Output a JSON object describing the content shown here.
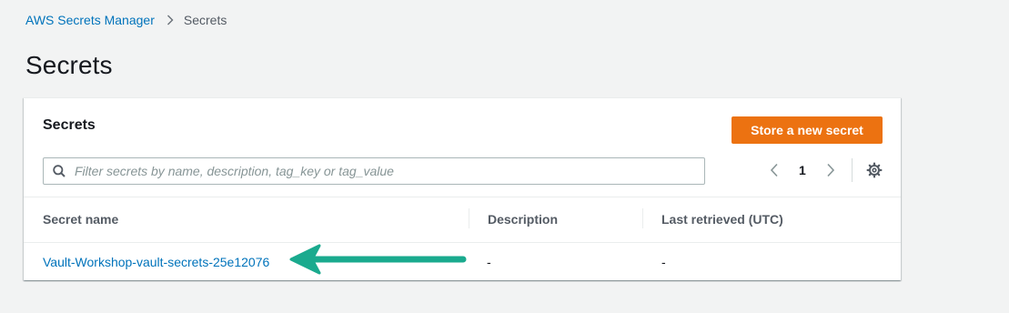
{
  "breadcrumb": {
    "root": "AWS Secrets Manager",
    "current": "Secrets"
  },
  "page": {
    "title": "Secrets"
  },
  "panel": {
    "title": "Secrets",
    "primary_button": "Store a new secret",
    "search_placeholder": "Filter secrets by name, description, tag_key or tag_value",
    "search_value": "",
    "pagination": {
      "current_page": "1"
    }
  },
  "table": {
    "columns": [
      "Secret name",
      "Description",
      "Last retrieved (UTC)"
    ],
    "rows": [
      {
        "name": "Vault-Workshop-vault-secrets-25e12076",
        "description": "-",
        "last_retrieved": "-"
      }
    ]
  },
  "colors": {
    "primary": "#ec7211",
    "link": "#0073bb",
    "annotation_arrow": "#1aaa8e"
  },
  "icons": {
    "breadcrumb_separator": "chevron-right-icon",
    "search": "search-icon",
    "prev_page": "chevron-left-icon",
    "next_page": "chevron-right-icon",
    "settings": "gear-icon",
    "annotation": "arrow-left-icon"
  }
}
